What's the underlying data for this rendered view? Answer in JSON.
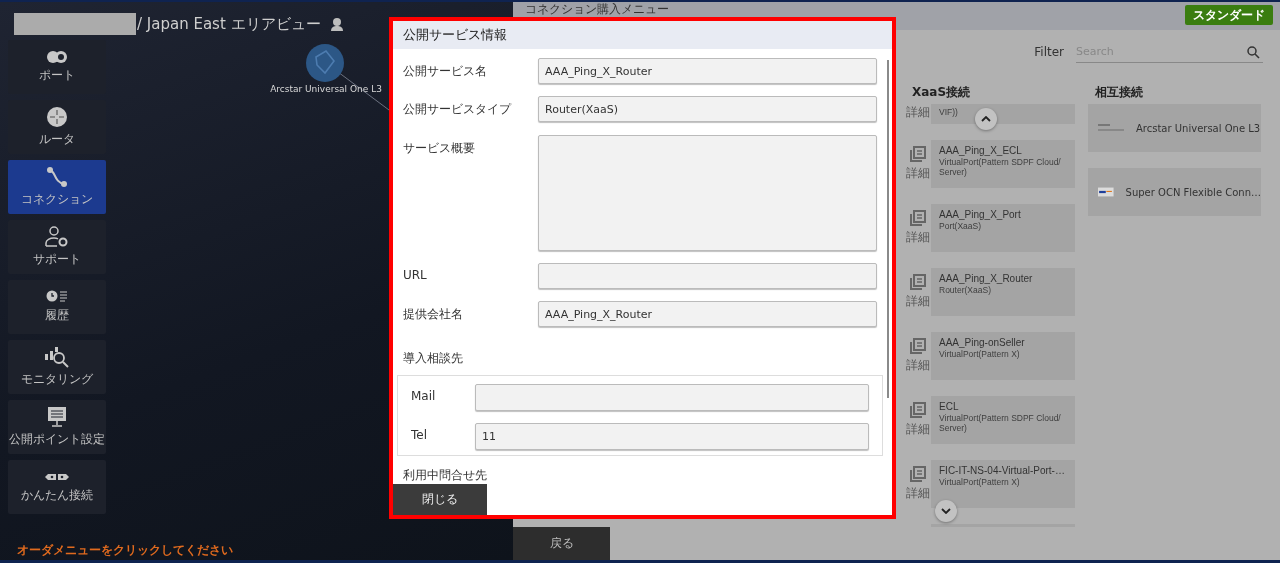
{
  "area_header": {
    "title": "/ Japan East エリアビュー"
  },
  "sidebar": {
    "items": [
      {
        "label": "ポート",
        "selected": false
      },
      {
        "label": "ルータ",
        "selected": false
      },
      {
        "label": "コネクション",
        "selected": true
      },
      {
        "label": "サポート",
        "selected": false
      },
      {
        "label": "履歴",
        "selected": false
      },
      {
        "label": "モニタリング",
        "selected": false
      },
      {
        "label": "公開ポイント設定",
        "selected": false
      },
      {
        "label": "かんたん接続",
        "selected": false
      }
    ]
  },
  "canvas": {
    "node_label": "Arcstar Universal One L3"
  },
  "hint": "オーダメニューをクリックしてください",
  "purchase_menu": {
    "title": "コネクション購入メニュー",
    "plan_button": "スタンダード",
    "filter_label": "Filter",
    "search": {
      "placeholder": "Search"
    },
    "xaas": {
      "heading": "XaaS接続",
      "cards": [
        {
          "kind": "clipped",
          "subtitle": "VIF))",
          "detail": "詳細"
        },
        {
          "kind": "full",
          "title": "AAA_Ping_X_ECL",
          "subtitle": "VirtualPort(Pattern SDPF Cloud/ Server)",
          "detail": "詳細"
        },
        {
          "kind": "full",
          "title": "AAA_Ping_X_Port",
          "subtitle": "Port(XaaS)",
          "detail": "詳細"
        },
        {
          "kind": "full",
          "title": "AAA_Ping_X_Router",
          "subtitle": "Router(XaaS)",
          "detail": "詳細"
        },
        {
          "kind": "full",
          "title": "AAA_Ping-onSeller",
          "subtitle": "VirtualPort(Pattern X)",
          "detail": "詳細"
        },
        {
          "kind": "full",
          "title": "ECL",
          "subtitle": "VirtualPort(Pattern SDPF Cloud/ Server)",
          "detail": "詳細"
        },
        {
          "kind": "full",
          "title": "FIC-IT-NS-04-Virtual-Port-…",
          "subtitle": "VirtualPort(Pattern X)",
          "detail": "詳細"
        }
      ]
    },
    "interconnect": {
      "heading": "相互接続",
      "cards": [
        {
          "name": "Arcstar Universal One L3"
        },
        {
          "name": "Super OCN Flexible Conn…"
        }
      ]
    },
    "back_button": "戻る"
  },
  "dialog": {
    "title": "公開サービス情報",
    "fields": [
      {
        "kind": "input",
        "label": "公開サービス名",
        "value": "AAA_Ping_X_Router"
      },
      {
        "kind": "input",
        "label": "公開サービスタイプ",
        "value": "Router(XaaS)"
      },
      {
        "kind": "textarea",
        "label": "サービス概要"
      },
      {
        "kind": "input",
        "label": "URL"
      },
      {
        "kind": "input",
        "label": "提供会社名",
        "value": "AAA_Ping_X_Router"
      }
    ],
    "contact": {
      "heading": "導入相談先",
      "fields": [
        {
          "label": "Mail"
        },
        {
          "label": "Tel",
          "value": "11"
        }
      ]
    },
    "next_heading": "利用中問合せ先",
    "close_button": "閉じる"
  }
}
